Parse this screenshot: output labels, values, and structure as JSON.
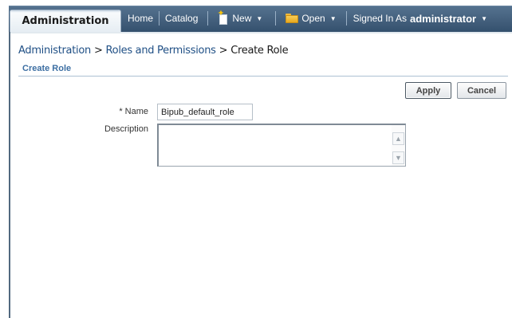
{
  "header": {
    "active_tab": "Administration",
    "nav": {
      "home": "Home",
      "catalog": "Catalog",
      "new": "New",
      "open": "Open",
      "signed_in_prefix": "Signed In As",
      "user": "administrator"
    }
  },
  "breadcrumb": {
    "item1": "Administration",
    "item2": "Roles and Permissions",
    "item3": "Create Role",
    "separator": ">"
  },
  "section": {
    "title": "Create Role"
  },
  "buttons": {
    "apply": "Apply",
    "cancel": "Cancel"
  },
  "form": {
    "name_label": "Name",
    "name_required_mark": "*",
    "name_value": "Bipub_default_role",
    "description_label": "Description",
    "description_value": ""
  },
  "icons": {
    "new": "new-document-star-icon",
    "open": "folder-icon",
    "dropdown": "chevron-down-icon"
  },
  "colors": {
    "header_band": "#34506d",
    "link": "#1f4f85",
    "section_title": "#3d6fa3"
  }
}
